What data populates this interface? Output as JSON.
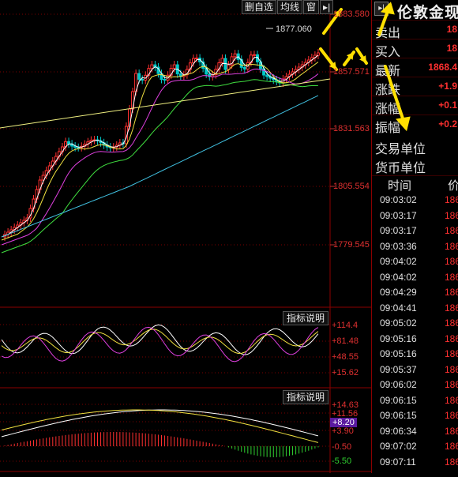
{
  "toolbar": {
    "watchlist_label": "删自选",
    "ma_label": "均线",
    "window_label": "窗",
    "arrow_label": "▸|"
  },
  "price_axis": [
    "1883.580",
    "1857.571",
    "1831.563",
    "1805.554",
    "1779.545"
  ],
  "high_marker": "1877.060",
  "indicator1": {
    "button_label": "指标说明",
    "axis": [
      "+114.4",
      "+81.48",
      "+48.55",
      "+15.62"
    ]
  },
  "indicator2": {
    "button_label": "指标说明",
    "axis": [
      "+14.63",
      "+11.56",
      "+8.20",
      "+3.90",
      "-0.50",
      "-5.50"
    ],
    "current_value": "+8.20"
  },
  "colors": {
    "up": "#ff3030",
    "down": "#00c8c8",
    "ma5": "#ffffff",
    "ma10": "#f0e040",
    "ma20": "#e040e0",
    "ma40": "#40e040",
    "ma60": "#40c0e0",
    "ma120": "#f0f080",
    "highlight_arrow": "#ffe000",
    "current_value_bg": "#5a1aa0"
  },
  "right_panel": {
    "arrow_label": "▸|",
    "title": "伦敦金现",
    "quotes": [
      {
        "label": "卖出",
        "value": "18"
      },
      {
        "label": "买入",
        "value": "18"
      },
      {
        "label": "最新",
        "value": "1868.4"
      },
      {
        "label": "涨跌",
        "value": "+1.9"
      },
      {
        "label": "涨幅",
        "value": "+0.1"
      },
      {
        "label": "振幅",
        "value": "+0.2"
      }
    ],
    "trade_unit_label": "交易单位",
    "currency_unit_label": "货币单位",
    "tick_header": {
      "time": "时间",
      "price": "价"
    },
    "ticks": [
      {
        "time": "09:03:02",
        "price": "186"
      },
      {
        "time": "09:03:17",
        "price": "186"
      },
      {
        "time": "09:03:17",
        "price": "186"
      },
      {
        "time": "09:03:36",
        "price": "186"
      },
      {
        "time": "09:04:02",
        "price": "186"
      },
      {
        "time": "09:04:02",
        "price": "186"
      },
      {
        "time": "09:04:29",
        "price": "186"
      },
      {
        "time": "09:04:41",
        "price": "186"
      },
      {
        "time": "09:05:02",
        "price": "186"
      },
      {
        "time": "09:05:16",
        "price": "186"
      },
      {
        "time": "09:05:16",
        "price": "186"
      },
      {
        "time": "09:05:37",
        "price": "186"
      },
      {
        "time": "09:06:02",
        "price": "186"
      },
      {
        "time": "09:06:15",
        "price": "186"
      },
      {
        "time": "09:06:15",
        "price": "186"
      },
      {
        "time": "09:06:34",
        "price": "186"
      },
      {
        "time": "09:07:02",
        "price": "186"
      },
      {
        "time": "09:07:11",
        "price": "186"
      }
    ]
  }
}
